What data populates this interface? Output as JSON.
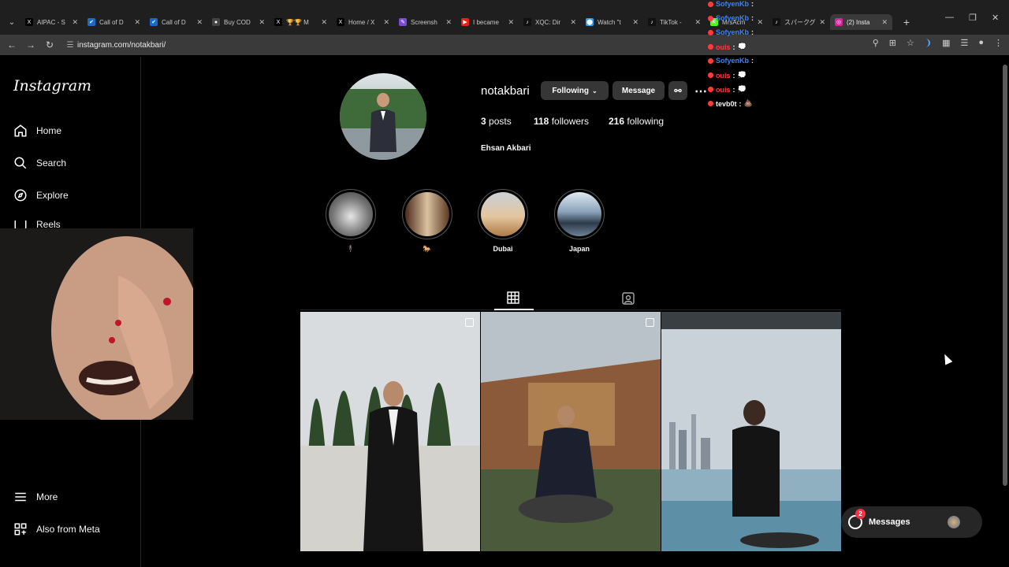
{
  "browser": {
    "tabs": [
      {
        "title": "AIPAC - S",
        "icon": "x-logo-icon"
      },
      {
        "title": "Call of D",
        "icon": "steam-icon"
      },
      {
        "title": "Call of D",
        "icon": "steam-icon"
      },
      {
        "title": "Buy COD",
        "icon": "generic-site-icon"
      },
      {
        "title": "🏆🏆 M",
        "icon": "x-logo-icon"
      },
      {
        "title": "Home / X",
        "icon": "x-logo-icon"
      },
      {
        "title": "Screensh",
        "icon": "pen-icon"
      },
      {
        "title": "I became",
        "icon": "youtube-icon"
      },
      {
        "title": "XQC: Dir",
        "icon": "tiktok-icon"
      },
      {
        "title": "Watch \"t",
        "icon": "watch-icon"
      },
      {
        "title": "TikTok -",
        "icon": "tiktok-icon"
      },
      {
        "title": "MrsAcm",
        "icon": "kick-icon"
      },
      {
        "title": "スパークグ",
        "icon": "tiktok-icon"
      },
      {
        "title": "(2) Insta",
        "icon": "instagram-icon"
      }
    ],
    "url": "instagram.com/notakbari/"
  },
  "sidebar": {
    "logo": "Instagram",
    "items": [
      {
        "label": "Home",
        "icon": "home-icon"
      },
      {
        "label": "Search",
        "icon": "search-icon"
      },
      {
        "label": "Explore",
        "icon": "compass-icon"
      },
      {
        "label": "Reels",
        "icon": "reels-icon"
      },
      {
        "label": "More",
        "icon": "menu-icon"
      },
      {
        "label": "Also from Meta",
        "icon": "meta-icon"
      }
    ]
  },
  "profile": {
    "username": "notakbari",
    "following_btn": "Following",
    "message_btn": "Message",
    "posts_count": "3",
    "posts_label": "posts",
    "followers_count": "118",
    "followers_label": "followers",
    "following_count": "216",
    "following_label": "following",
    "full_name": "Ehsan Akbari"
  },
  "highlights": [
    {
      "label": "🕴️"
    },
    {
      "label": "🐎"
    },
    {
      "label": "Dubai"
    },
    {
      "label": "Japan"
    }
  ],
  "chat": [
    {
      "user": "SofyenKb",
      "color": "#3b82f6",
      "text": ""
    },
    {
      "user": "SofyenKb",
      "color": "#3b82f6",
      "text": ""
    },
    {
      "user": "SofyenKb",
      "color": "#3b82f6",
      "text": ""
    },
    {
      "user": "ouis",
      "color": "#ff3b3b",
      "text": "💭"
    },
    {
      "user": "SofyenKb",
      "color": "#3b82f6",
      "text": ""
    },
    {
      "user": "ouis",
      "color": "#ff3b3b",
      "text": "💭"
    },
    {
      "user": "ouis",
      "color": "#ff3b3b",
      "text": "💭"
    },
    {
      "user": "tevb0t",
      "color": "#f5f5f5",
      "text": "💩"
    }
  ],
  "messages": {
    "label": "Messages",
    "badge": "2"
  }
}
